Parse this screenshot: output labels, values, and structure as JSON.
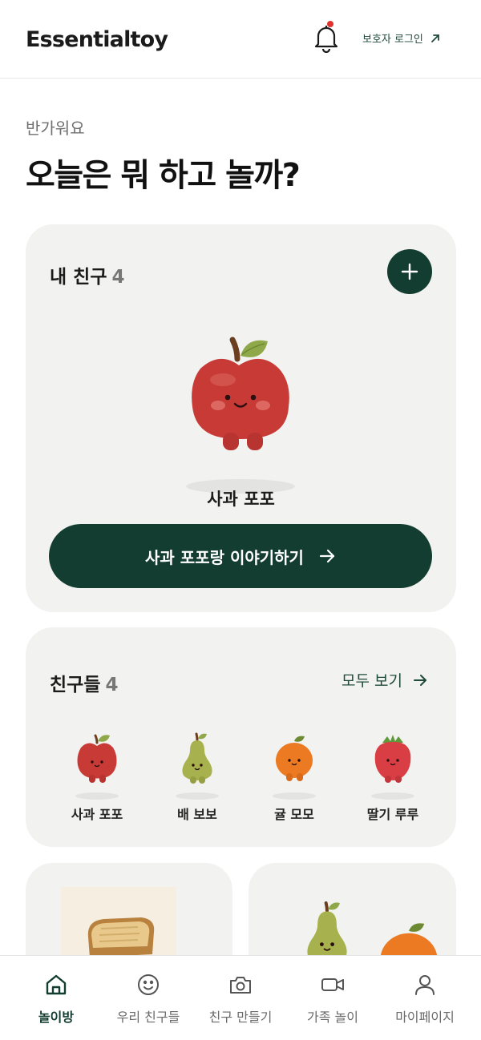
{
  "header": {
    "logo": "Essentialtoy",
    "guardian_login": "보호자 로그인",
    "icons": {
      "bell": "bell-icon",
      "arrow": "arrow-up-right-icon"
    }
  },
  "greeting": {
    "subtitle": "반가워요",
    "title": "오늘은 뭐 하고 놀까?"
  },
  "my_friend": {
    "title": "내 친구",
    "count": "4",
    "featured_name": "사과 포포",
    "talk_button": "사과 포포랑 이야기하기",
    "icons": {
      "add": "plus-icon",
      "arrow": "arrow-right-icon"
    }
  },
  "friends": {
    "title": "친구들",
    "count": "4",
    "see_all": "모두 보기",
    "items": [
      {
        "name": "사과 포포",
        "character": "apple"
      },
      {
        "name": "배 보보",
        "character": "pear"
      },
      {
        "name": "귤 모모",
        "character": "tangerine"
      },
      {
        "name": "딸기 루루",
        "character": "strawberry"
      }
    ]
  },
  "tabs": [
    {
      "label": "놀이방",
      "icon": "home-icon",
      "active": true
    },
    {
      "label": "우리 친구들",
      "icon": "smile-icon",
      "active": false
    },
    {
      "label": "친구 만들기",
      "icon": "camera-icon",
      "active": false
    },
    {
      "label": "가족 놀이",
      "icon": "video-icon",
      "active": false
    },
    {
      "label": "마이페이지",
      "icon": "user-icon",
      "active": false
    }
  ],
  "colors": {
    "brand_dark_green": "#133d30",
    "card_bg": "#f2f2f0",
    "notification_dot": "#e0322e",
    "apple_red": "#c83a36",
    "pear_green": "#a7b24e",
    "tangerine_orange": "#ec7a22",
    "strawberry_red": "#d83e44"
  }
}
